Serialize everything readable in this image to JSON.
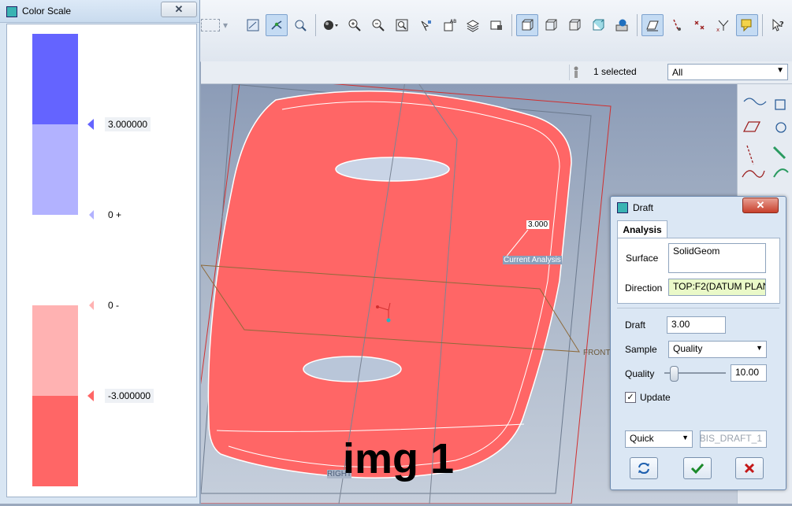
{
  "color_scale": {
    "title": "Color Scale",
    "labels": [
      "3.000000",
      "0 +",
      "0 -",
      "-3.000000"
    ]
  },
  "toolbar": {
    "icons": [
      "refit-icon",
      "datum-display-icon",
      "spin-center-icon",
      "shading-icon",
      "zoom-in-icon",
      "zoom-out-icon",
      "refit-view-icon",
      "reorient-icon",
      "saved-views-icon",
      "layers-icon",
      "shading-edges-icon",
      "wireframe-icon",
      "hidden-line-icon",
      "no-hidden-icon",
      "shaded-icon",
      "plane-display-icon",
      "axis-display-icon",
      "point-display-icon",
      "csys-display-icon",
      "annotation-display-icon",
      "help-icon"
    ]
  },
  "selection": {
    "status": "1 selected",
    "filter": "All"
  },
  "viewport": {
    "annotation_value": "3.000",
    "annotation_label": "Current Analysis",
    "plane_front": "FRONT",
    "plane_right": "RIGHT",
    "overlay_text": "img 1",
    "accent_model": "#ff6666"
  },
  "draft": {
    "title": "Draft",
    "tab": "Analysis",
    "surface_label": "Surface",
    "surface_value": "SolidGeom",
    "direction_label": "Direction",
    "direction_value": "TOP:F2(DATUM PLAN",
    "draft_label": "Draft",
    "draft_value": "3.00",
    "sample_label": "Sample",
    "sample_value": "Quality",
    "quality_label": "Quality",
    "quality_value": "10.00",
    "update_label": "Update",
    "update_checked": true,
    "mode_value": "Quick",
    "name_value": "BIS_DRAFT_1"
  }
}
